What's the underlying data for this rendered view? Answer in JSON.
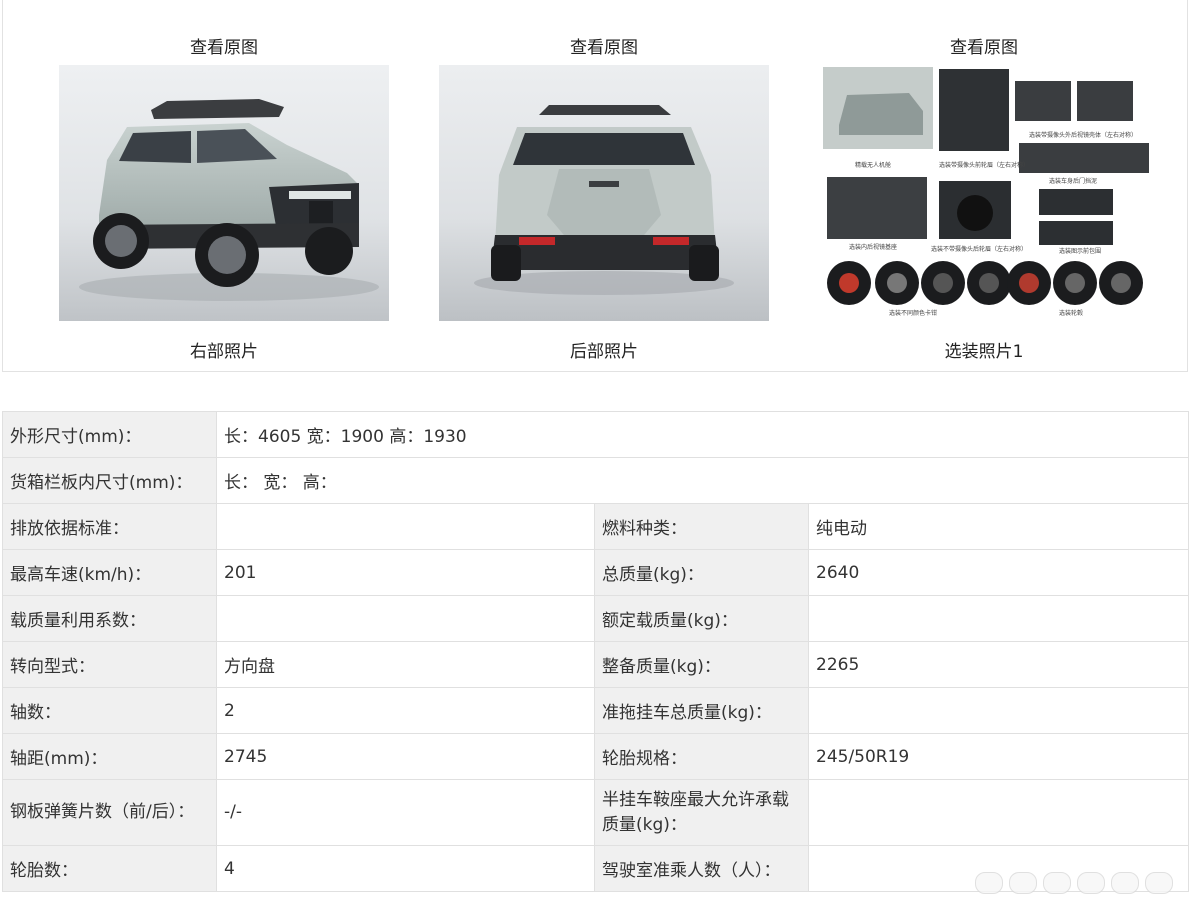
{
  "gallery": [
    {
      "view_label": "查看原图",
      "caption": "右部照片"
    },
    {
      "view_label": "查看原图",
      "caption": "后部照片"
    },
    {
      "view_label": "查看原图",
      "caption": "选装照片1"
    }
  ],
  "option_sheet_labels": [
    "精载无人机舱",
    "选装带摄像头前轮眉（左右对称）",
    "选装带摄像头外后视镜壳体（左右对称）",
    "选装车身后门挡泥",
    "选装内后视镜基座",
    "选装不带摄像头后轮眉（左右对称）",
    "选装图示前包围",
    "选装不同颜色卡钳",
    "选装轮毂"
  ],
  "specs": {
    "dimensions_label": "外形尺寸(mm)：",
    "dimensions_value": "长：4605 宽：1900 高：1930",
    "cargo_label": "货箱栏板内尺寸(mm)：",
    "cargo_value": "长： 宽： 高：",
    "rows": [
      {
        "l1": "排放依据标准：",
        "v1": "",
        "l2": "燃料种类：",
        "v2": "纯电动"
      },
      {
        "l1": "最高车速(km/h)：",
        "v1": "201",
        "l2": "总质量(kg)：",
        "v2": "2640"
      },
      {
        "l1": "载质量利用系数：",
        "v1": "",
        "l2": "额定载质量(kg)：",
        "v2": ""
      },
      {
        "l1": "转向型式：",
        "v1": "方向盘",
        "l2": "整备质量(kg)：",
        "v2": "2265"
      },
      {
        "l1": "轴数：",
        "v1": "2",
        "l2": "准拖挂车总质量(kg)：",
        "v2": ""
      },
      {
        "l1": "轴距(mm)：",
        "v1": "2745",
        "l2": "轮胎规格：",
        "v2": "245/50R19"
      },
      {
        "l1": "钢板弹簧片数（前/后）：",
        "v1": "-/-",
        "l2": "半挂车鞍座最大允许承载质量(kg)：",
        "v2": ""
      },
      {
        "l1": "轮胎数：",
        "v1": "4",
        "l2": "驾驶室准乘人数（人）：",
        "v2": ""
      }
    ]
  }
}
